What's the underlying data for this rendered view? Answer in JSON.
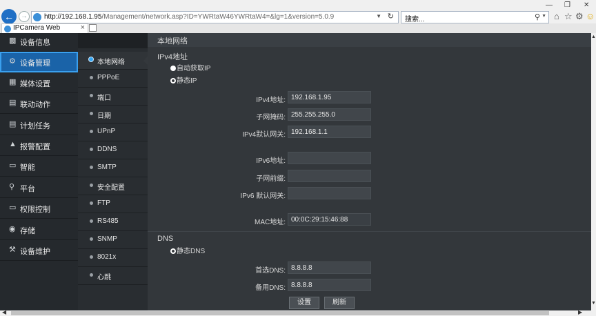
{
  "browser": {
    "url_host": "http://192.168.1.95",
    "url_path": "/Management/network.asp?ID=YWRtaW46YWRtaW4=&lg=1&version=5.0.9",
    "search_text": "搜索...",
    "tab_title": "IPCamera Web"
  },
  "main_nav": [
    {
      "label": "设备信息",
      "icon": "camera-icon"
    },
    {
      "label": "设备管理",
      "icon": "gear-icon",
      "active": true
    },
    {
      "label": "媒体设置",
      "icon": "media-icon"
    },
    {
      "label": "联动动作",
      "icon": "link-icon"
    },
    {
      "label": "计划任务",
      "icon": "calendar-icon"
    },
    {
      "label": "报警配置",
      "icon": "alarm-icon"
    },
    {
      "label": "智能",
      "icon": "monitor-icon"
    },
    {
      "label": "平台",
      "icon": "wrench-icon"
    },
    {
      "label": "权限控制",
      "icon": "monitor-icon"
    },
    {
      "label": "存储",
      "icon": "disk-icon"
    },
    {
      "label": "设备维护",
      "icon": "wrench-icon"
    }
  ],
  "sub_nav": [
    {
      "label": "本地网络",
      "active": true
    },
    {
      "label": "PPPoE"
    },
    {
      "label": "端口"
    },
    {
      "label": "日期"
    },
    {
      "label": "UPnP"
    },
    {
      "label": "DDNS"
    },
    {
      "label": "SMTP"
    },
    {
      "label": "安全配置"
    },
    {
      "label": "FTP"
    },
    {
      "label": "RS485"
    },
    {
      "label": "SNMP"
    },
    {
      "label": "8021x"
    },
    {
      "label": "心跳"
    }
  ],
  "content": {
    "header": "本地网络",
    "ipv4_title": "IPv4地址",
    "radio_auto": "自动获取IP",
    "radio_static": "静态IP",
    "ipv4_address_label": "IPv4地址:",
    "ipv4_address": "192.168.1.95",
    "subnet_label": "子网掩码:",
    "subnet": "255.255.255.0",
    "gateway_label": "IPv4默认网关:",
    "gateway": "192.168.1.1",
    "ipv6_address_label": "IPv6地址:",
    "ipv6_address": "",
    "prefix_label": "子网前缀:",
    "prefix": "",
    "ipv6_gateway_label": "IPv6 默认网关:",
    "ipv6_gateway": "",
    "mac_label": "MAC地址:",
    "mac": "00:0C:29:15:46:88",
    "dns_title": "DNS",
    "radio_static_dns": "静态DNS",
    "dns1_label": "首选DNS:",
    "dns1": "8.8.8.8",
    "dns2_label": "备用DNS:",
    "dns2": "8.8.8.8",
    "save_button": "设置",
    "refresh_button": "刷新"
  }
}
